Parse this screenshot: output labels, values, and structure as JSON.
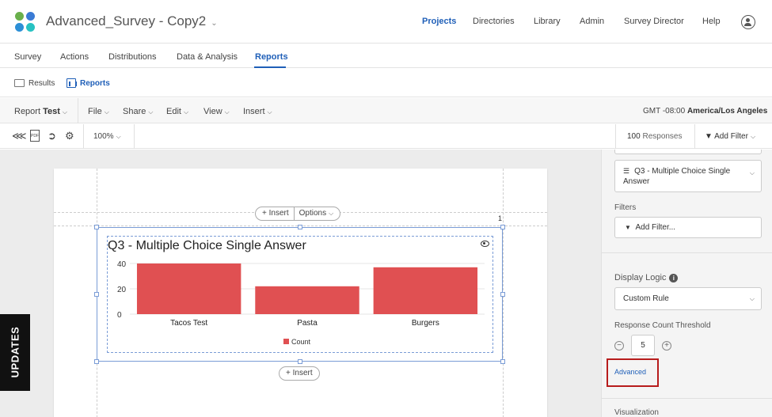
{
  "header": {
    "app_title": "Advanced_Survey - Copy2",
    "nav": [
      "Projects",
      "Directories",
      "Library",
      "Admin",
      "Survey Director",
      "Help"
    ],
    "active_nav": "Projects",
    "logo_colors": [
      "#6ab04c",
      "#3a7bd5",
      "#2c8fd6",
      "#28c2c2"
    ]
  },
  "subnav": {
    "items": [
      "Survey",
      "Actions",
      "Distributions",
      "Data & Analysis",
      "Reports"
    ],
    "active": "Reports"
  },
  "tabs3": {
    "results_label": "Results",
    "reports_label": "Reports"
  },
  "toolbar": {
    "report_prefix": "Report",
    "report_name": "Test",
    "menus": [
      "File",
      "Share",
      "Edit",
      "View",
      "Insert"
    ],
    "timezone_prefix": "GMT -08:00",
    "timezone_name": "America/Los Angeles"
  },
  "iconrow": {
    "zoom": "100%",
    "responses_count": "100",
    "responses_label": "Responses",
    "add_filter": "Add Filter"
  },
  "canvas": {
    "insert_label": "Insert",
    "options_label": "Options",
    "page_number": "1",
    "insert_bottom_label": "Insert"
  },
  "chart_data": {
    "type": "bar",
    "title": "Q3 - Multiple Choice Single Answer",
    "categories": [
      "Tacos Test",
      "Pasta",
      "Burgers"
    ],
    "series": [
      {
        "name": "Count",
        "values": [
          40,
          22,
          37
        ],
        "color": "#e05052"
      }
    ],
    "yticks": [
      0,
      20,
      40
    ],
    "ylim": [
      0,
      40
    ],
    "grid": true,
    "legend": "bottom"
  },
  "updates": {
    "label": "UPDATES"
  },
  "panel": {
    "question_select": "Q3 - Multiple Choice Single Answer",
    "filters_label": "Filters",
    "add_filter_label": "Add Filter...",
    "display_logic_label": "Display Logic",
    "display_logic_value": "Custom Rule",
    "threshold_label": "Response Count Threshold",
    "threshold_value": "5",
    "advanced_label": "Advanced",
    "visualization_label": "Visualization"
  }
}
